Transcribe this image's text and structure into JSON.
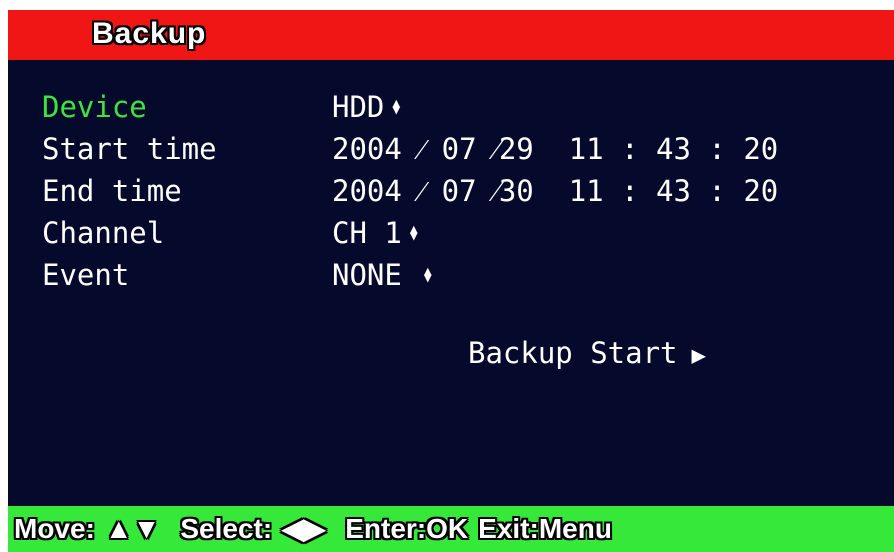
{
  "title": "Backup",
  "colors": {
    "title_bar": "#f01616",
    "background": "#050a2c",
    "footer_bar": "#35e83a",
    "active_label": "#3ee43e",
    "text": "#ffffff"
  },
  "rows": {
    "device": {
      "label": "Device",
      "value": "HDD",
      "icon": "up-down-arrow-icon"
    },
    "start_time": {
      "label": "Start time",
      "year": "2004",
      "month": "07",
      "day": "29",
      "hour": "11",
      "minute": "43",
      "second": "20"
    },
    "end_time": {
      "label": "End time",
      "year": "2004",
      "month": "07",
      "day": "30",
      "hour": "11",
      "minute": "43",
      "second": "20"
    },
    "channel": {
      "label": "Channel",
      "value": "CH 1",
      "icon": "up-down-arrow-icon"
    },
    "event": {
      "label": "Event",
      "value": "NONE",
      "icon": "up-down-arrow-icon"
    }
  },
  "backup_start": {
    "label": "Backup Start",
    "icon": "play-arrow-icon"
  },
  "footer": {
    "move_label": "Move:",
    "move_icons": "up-down-triangle-icons",
    "select_label": "Select:",
    "select_icons": "left-right-triangle-icons",
    "enter": "Enter:OK",
    "exit": "Exit:Menu"
  }
}
